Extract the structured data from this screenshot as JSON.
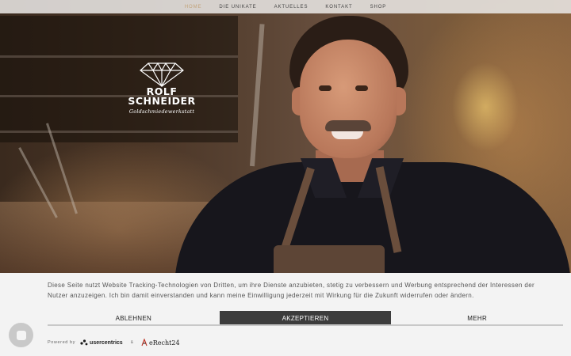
{
  "nav": {
    "items": [
      {
        "label": "HOME",
        "active": true
      },
      {
        "label": "DIE UNIKATE",
        "active": false
      },
      {
        "label": "AKTUELLES",
        "active": false
      },
      {
        "label": "KONTAKT",
        "active": false
      },
      {
        "label": "SHOP",
        "active": false
      }
    ],
    "active_color": "#c2a37a"
  },
  "logo": {
    "line1": "ROLF",
    "line2": "SCHNEIDER",
    "subtitle": "Goldschmiedewerkstatt",
    "icon": "diamond-icon"
  },
  "cookie_banner": {
    "text": "Diese Seite nutzt Website Tracking-Technologien von Dritten, um ihre Dienste anzubieten, stetig zu verbessern und Werbung entsprechend der Interessen der Nutzer anzuzeigen. Ich bin damit einverstanden und kann meine Einwilligung jederzeit mit Wirkung für die Zukunft widerrufen oder ändern.",
    "buttons": {
      "decline": "ABLEHNEN",
      "accept": "AKZEPTIEREN",
      "more": "MEHR"
    },
    "powered_by": "Powered by",
    "provider1": "usercentrics",
    "amp": "&",
    "provider2": "eRecht24",
    "accept_color": "#3c3c3c"
  },
  "privacy_button": {
    "icon": "privacy-settings-icon"
  }
}
